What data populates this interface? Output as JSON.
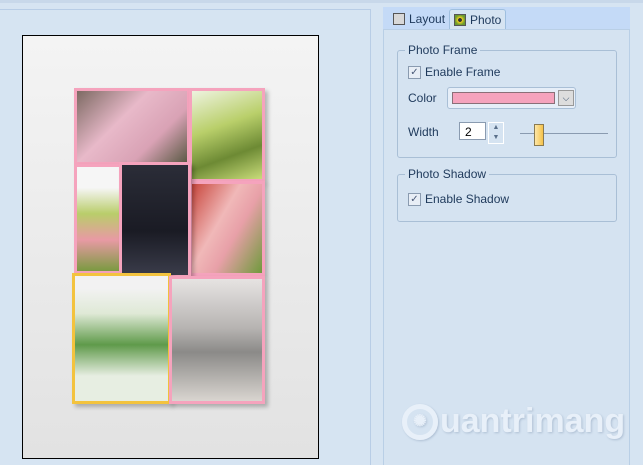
{
  "tabs": [
    {
      "label": "Layout",
      "icon": "layout-icon"
    },
    {
      "label": "Photo",
      "icon": "photo-icon",
      "active": true
    }
  ],
  "photo_frame": {
    "title": "Photo Frame",
    "enable_label": "Enable Frame",
    "enabled": true,
    "color_label": "Color",
    "color_value": "#f5a3bd",
    "width_label": "Width",
    "width_value": "2",
    "slider_fraction": 0.15
  },
  "photo_shadow": {
    "title": "Photo Shadow",
    "enable_label": "Enable Shadow",
    "enabled": true
  },
  "collage": [
    "cherry-blossom-path",
    "tree-branch",
    "pink-flowers-left",
    "portrait",
    "pink-flowers-right",
    "white-flowers",
    "friends-sitting"
  ],
  "watermark": "uantrimang"
}
